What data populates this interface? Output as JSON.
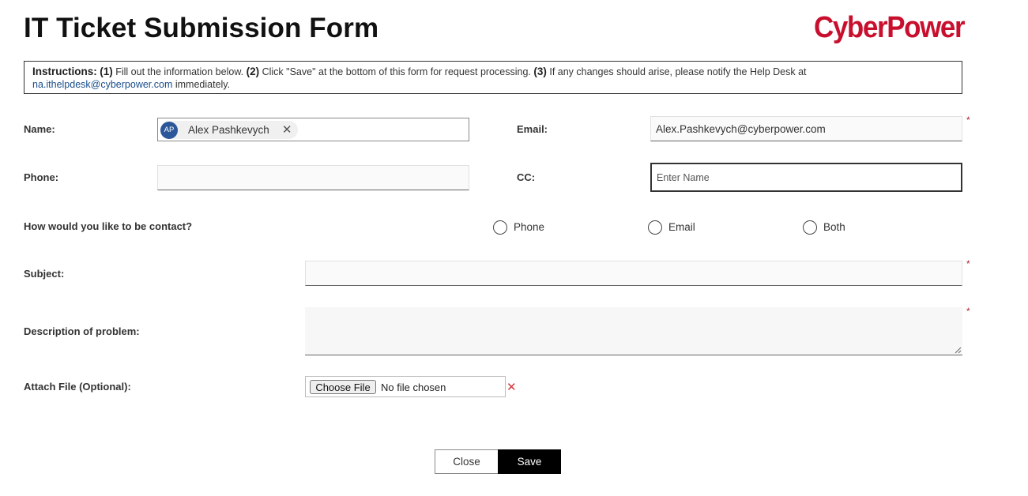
{
  "header": {
    "title": "IT Ticket Submission Form",
    "logo_text": "CyberPower"
  },
  "instructions": {
    "label": "Instructions:",
    "step1_num": "(1)",
    "step1_text": "Fill out the information below.",
    "step2_num": "(2)",
    "step2_text": "Click \"Save\" at the bottom of this form for request processing.",
    "step3_num": "(3)",
    "step3_text": "If any changes should arise, please notify the Help Desk at",
    "email": "na.ithelpdesk@cyberpower.com",
    "suffix": "immediately."
  },
  "fields": {
    "name": {
      "label": "Name:",
      "initials": "AP",
      "value": "Alex Pashkevych",
      "remove_glyph": "✕"
    },
    "email": {
      "label": "Email:",
      "value": "Alex.Pashkevych@cyberpower.com",
      "required": "*"
    },
    "phone": {
      "label": "Phone:",
      "value": ""
    },
    "cc": {
      "label": "CC:",
      "placeholder": "Enter Name"
    },
    "contact": {
      "label": "How would you like to be contact?",
      "options": [
        "Phone",
        "Email",
        "Both"
      ]
    },
    "subject": {
      "label": "Subject:",
      "value": "",
      "required": "*"
    },
    "description": {
      "label": "Description of problem:",
      "value": "",
      "required": "*"
    },
    "attach": {
      "label": "Attach File (Optional):",
      "button": "Choose File",
      "status": "No file chosen",
      "clear_glyph": "✕"
    }
  },
  "buttons": {
    "close": "Close",
    "save": "Save"
  },
  "colors": {
    "brand": "#c8102e",
    "required": "#a4262c",
    "avatar": "#2b579a",
    "save_bg": "#000000",
    "link": "#1a4e8a"
  }
}
